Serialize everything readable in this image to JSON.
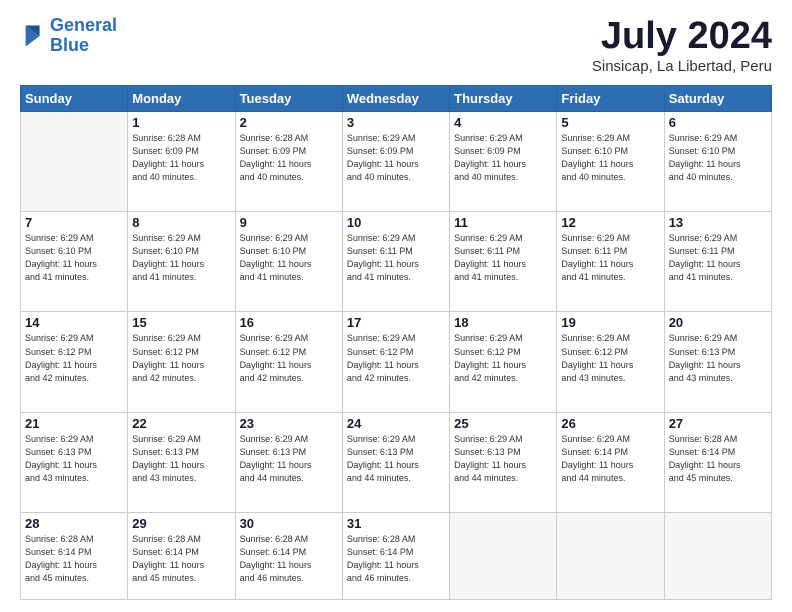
{
  "logo": {
    "line1": "General",
    "line2": "Blue"
  },
  "title": "July 2024",
  "location": "Sinsicap, La Libertad, Peru",
  "days_header": [
    "Sunday",
    "Monday",
    "Tuesday",
    "Wednesday",
    "Thursday",
    "Friday",
    "Saturday"
  ],
  "weeks": [
    [
      {
        "day": "",
        "empty": true
      },
      {
        "day": "1",
        "sunrise": "6:28 AM",
        "sunset": "6:09 PM",
        "daylight": "11 hours and 40 minutes."
      },
      {
        "day": "2",
        "sunrise": "6:28 AM",
        "sunset": "6:09 PM",
        "daylight": "11 hours and 40 minutes."
      },
      {
        "day": "3",
        "sunrise": "6:29 AM",
        "sunset": "6:09 PM",
        "daylight": "11 hours and 40 minutes."
      },
      {
        "day": "4",
        "sunrise": "6:29 AM",
        "sunset": "6:09 PM",
        "daylight": "11 hours and 40 minutes."
      },
      {
        "day": "5",
        "sunrise": "6:29 AM",
        "sunset": "6:10 PM",
        "daylight": "11 hours and 40 minutes."
      },
      {
        "day": "6",
        "sunrise": "6:29 AM",
        "sunset": "6:10 PM",
        "daylight": "11 hours and 40 minutes."
      }
    ],
    [
      {
        "day": "7",
        "sunrise": "6:29 AM",
        "sunset": "6:10 PM",
        "daylight": "11 hours and 41 minutes."
      },
      {
        "day": "8",
        "sunrise": "6:29 AM",
        "sunset": "6:10 PM",
        "daylight": "11 hours and 41 minutes."
      },
      {
        "day": "9",
        "sunrise": "6:29 AM",
        "sunset": "6:10 PM",
        "daylight": "11 hours and 41 minutes."
      },
      {
        "day": "10",
        "sunrise": "6:29 AM",
        "sunset": "6:11 PM",
        "daylight": "11 hours and 41 minutes."
      },
      {
        "day": "11",
        "sunrise": "6:29 AM",
        "sunset": "6:11 PM",
        "daylight": "11 hours and 41 minutes."
      },
      {
        "day": "12",
        "sunrise": "6:29 AM",
        "sunset": "6:11 PM",
        "daylight": "11 hours and 41 minutes."
      },
      {
        "day": "13",
        "sunrise": "6:29 AM",
        "sunset": "6:11 PM",
        "daylight": "11 hours and 41 minutes."
      }
    ],
    [
      {
        "day": "14",
        "sunrise": "6:29 AM",
        "sunset": "6:12 PM",
        "daylight": "11 hours and 42 minutes."
      },
      {
        "day": "15",
        "sunrise": "6:29 AM",
        "sunset": "6:12 PM",
        "daylight": "11 hours and 42 minutes."
      },
      {
        "day": "16",
        "sunrise": "6:29 AM",
        "sunset": "6:12 PM",
        "daylight": "11 hours and 42 minutes."
      },
      {
        "day": "17",
        "sunrise": "6:29 AM",
        "sunset": "6:12 PM",
        "daylight": "11 hours and 42 minutes."
      },
      {
        "day": "18",
        "sunrise": "6:29 AM",
        "sunset": "6:12 PM",
        "daylight": "11 hours and 42 minutes."
      },
      {
        "day": "19",
        "sunrise": "6:29 AM",
        "sunset": "6:12 PM",
        "daylight": "11 hours and 43 minutes."
      },
      {
        "day": "20",
        "sunrise": "6:29 AM",
        "sunset": "6:13 PM",
        "daylight": "11 hours and 43 minutes."
      }
    ],
    [
      {
        "day": "21",
        "sunrise": "6:29 AM",
        "sunset": "6:13 PM",
        "daylight": "11 hours and 43 minutes."
      },
      {
        "day": "22",
        "sunrise": "6:29 AM",
        "sunset": "6:13 PM",
        "daylight": "11 hours and 43 minutes."
      },
      {
        "day": "23",
        "sunrise": "6:29 AM",
        "sunset": "6:13 PM",
        "daylight": "11 hours and 44 minutes."
      },
      {
        "day": "24",
        "sunrise": "6:29 AM",
        "sunset": "6:13 PM",
        "daylight": "11 hours and 44 minutes."
      },
      {
        "day": "25",
        "sunrise": "6:29 AM",
        "sunset": "6:13 PM",
        "daylight": "11 hours and 44 minutes."
      },
      {
        "day": "26",
        "sunrise": "6:29 AM",
        "sunset": "6:14 PM",
        "daylight": "11 hours and 44 minutes."
      },
      {
        "day": "27",
        "sunrise": "6:28 AM",
        "sunset": "6:14 PM",
        "daylight": "11 hours and 45 minutes."
      }
    ],
    [
      {
        "day": "28",
        "sunrise": "6:28 AM",
        "sunset": "6:14 PM",
        "daylight": "11 hours and 45 minutes."
      },
      {
        "day": "29",
        "sunrise": "6:28 AM",
        "sunset": "6:14 PM",
        "daylight": "11 hours and 45 minutes."
      },
      {
        "day": "30",
        "sunrise": "6:28 AM",
        "sunset": "6:14 PM",
        "daylight": "11 hours and 46 minutes."
      },
      {
        "day": "31",
        "sunrise": "6:28 AM",
        "sunset": "6:14 PM",
        "daylight": "11 hours and 46 minutes."
      },
      {
        "day": "",
        "empty": true
      },
      {
        "day": "",
        "empty": true
      },
      {
        "day": "",
        "empty": true
      }
    ]
  ]
}
